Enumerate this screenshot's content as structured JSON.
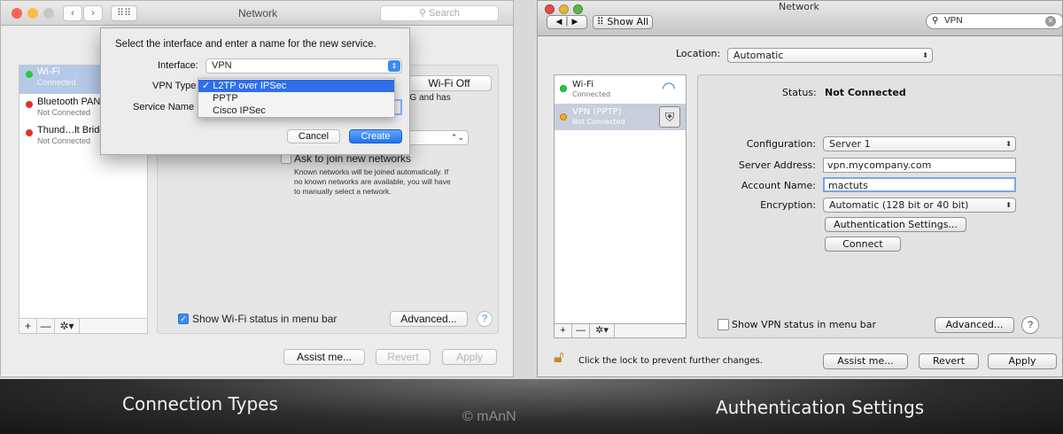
{
  "left_window": {
    "title": "Network",
    "search_placeholder": "Search",
    "services": [
      {
        "name": "Wi-Fi",
        "status": "Connected",
        "color": "#27c93f"
      },
      {
        "name": "Bluetooth PAN",
        "status": "Not Connected",
        "color": "#e0312a"
      },
      {
        "name": "Thund…lt Bridge",
        "status": "Not Connected",
        "color": "#e0312a"
      }
    ],
    "wifi_off_button": "Wi-Fi Off",
    "wifi_note": "5G and has",
    "ask_join_label": "Ask to join new networks",
    "ask_join_note": [
      "Known networks will be joined automatically. If",
      "no known networks are available, you will have",
      "to manually select a network."
    ],
    "show_status_label": "Show Wi-Fi status in menu bar",
    "advanced_button": "Advanced...",
    "help_button": "?",
    "assist_button": "Assist me...",
    "revert_button": "Revert",
    "apply_button": "Apply",
    "toolbar": {
      "add": "+",
      "remove": "—",
      "gear": "✲▾"
    },
    "dialog": {
      "heading": "Select the interface and enter a name for the new service.",
      "interface_label": "Interface:",
      "interface_value": "VPN",
      "vpn_type_label": "VPN Type",
      "service_name_label": "Service Name",
      "cancel_button": "Cancel",
      "create_button": "Create",
      "menu_options": [
        "✓ L2TP over IPSec",
        "PPTP",
        "Cisco IPSec"
      ]
    }
  },
  "right_window": {
    "title": "Network",
    "show_all_button": "Show All",
    "search_value": "VPN",
    "location_label": "Location:",
    "location_value": "Automatic",
    "services": [
      {
        "name": "Wi-Fi",
        "status": "Connected",
        "color": "#27c93f"
      },
      {
        "name": "VPN (PPTP)",
        "status": "Not Connected",
        "color": "#f4a62a"
      }
    ],
    "status_label": "Status:",
    "status_value": "Not Connected",
    "configuration_label": "Configuration:",
    "configuration_value": "Server 1",
    "server_address_label": "Server Address:",
    "server_address_value": "vpn.mycompany.com",
    "account_name_label": "Account Name:",
    "account_name_value": "mactuts",
    "encryption_label": "Encryption:",
    "encryption_value": "Automatic (128 bit or 40 bit)",
    "auth_settings_button": "Authentication Settings...",
    "connect_button": "Connect",
    "show_vpn_status_label": "Show VPN status in menu bar",
    "advanced_button": "Advanced...",
    "help_button": "?",
    "lock_text": "Click the lock to prevent further changes.",
    "assist_button": "Assist me...",
    "revert_button": "Revert",
    "apply_button": "Apply",
    "toolbar": {
      "add": "+",
      "remove": "—",
      "gear": "✲▾"
    }
  },
  "captions": {
    "left": "Connection Types",
    "right": "Authentication Settings",
    "watermark": "© mAnN"
  }
}
